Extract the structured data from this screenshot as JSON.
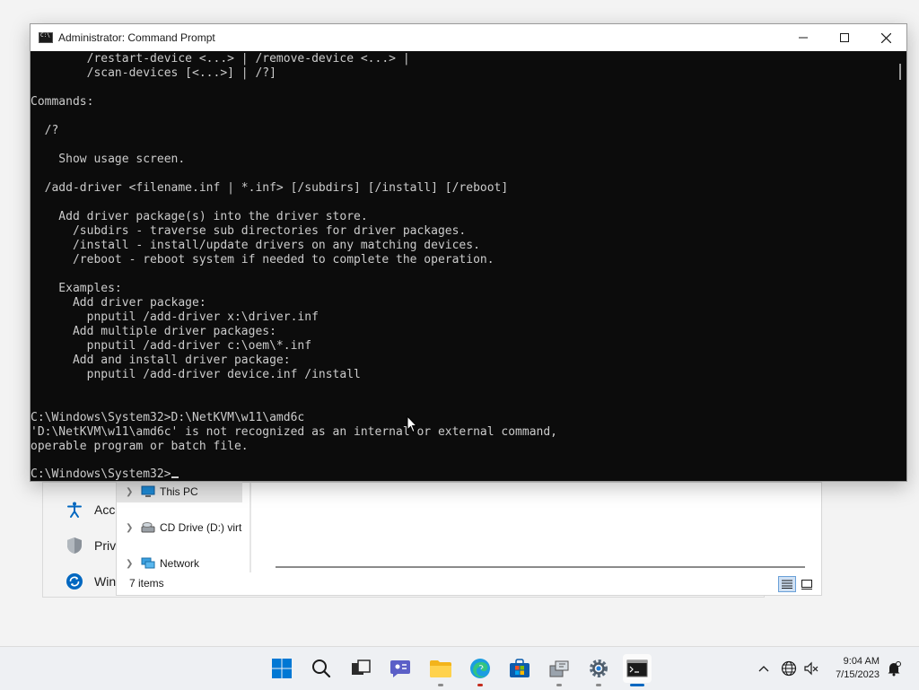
{
  "cmd": {
    "title": "Administrator: Command Prompt",
    "lines": [
      "        /restart-device <...> | /remove-device <...> |",
      "        /scan-devices [<...>] | /?]",
      "",
      "Commands:",
      "",
      "  /?",
      "",
      "    Show usage screen.",
      "",
      "  /add-driver <filename.inf | *.inf> [/subdirs] [/install] [/reboot]",
      "",
      "    Add driver package(s) into the driver store.",
      "      /subdirs - traverse sub directories for driver packages.",
      "      /install - install/update drivers on any matching devices.",
      "      /reboot - reboot system if needed to complete the operation.",
      "",
      "    Examples:",
      "      Add driver package:",
      "        pnputil /add-driver x:\\driver.inf",
      "      Add multiple driver packages:",
      "        pnputil /add-driver c:\\oem\\*.inf",
      "      Add and install driver package:",
      "        pnputil /add-driver device.inf /install",
      "",
      "",
      "C:\\Windows\\System32>D:\\NetKVM\\w11\\amd6c",
      "'D:\\NetKVM\\w11\\amd6c' is not recognized as an internal or external command,",
      "operable program or batch file.",
      ""
    ],
    "prompt": "C:\\Windows\\System32>"
  },
  "settings": {
    "items": [
      {
        "label": "Acc",
        "icon": "accessibility-icon"
      },
      {
        "label": "Priv",
        "icon": "shield-icon"
      },
      {
        "label": "Win",
        "icon": "windows-update-icon"
      }
    ]
  },
  "explorer": {
    "nav_items": [
      {
        "label": "This PC",
        "icon": "computer-icon"
      },
      {
        "label": "CD Drive (D:) virt",
        "icon": "cd-drive-icon"
      },
      {
        "label": "Network",
        "icon": "network-icon"
      }
    ],
    "status": "7 items"
  },
  "taskbar": {
    "time": "9:04 AM",
    "date": "7/15/2023",
    "apps": [
      "start-icon",
      "search-icon",
      "task-view-icon",
      "chat-icon",
      "file-explorer-icon",
      "edge-icon",
      "store-icon",
      "driver-installer-icon",
      "settings-icon",
      "command-prompt-icon"
    ]
  },
  "colors": {
    "console_bg": "#0c0c0c",
    "console_fg": "#cccccc",
    "accent": "#0067c0"
  }
}
